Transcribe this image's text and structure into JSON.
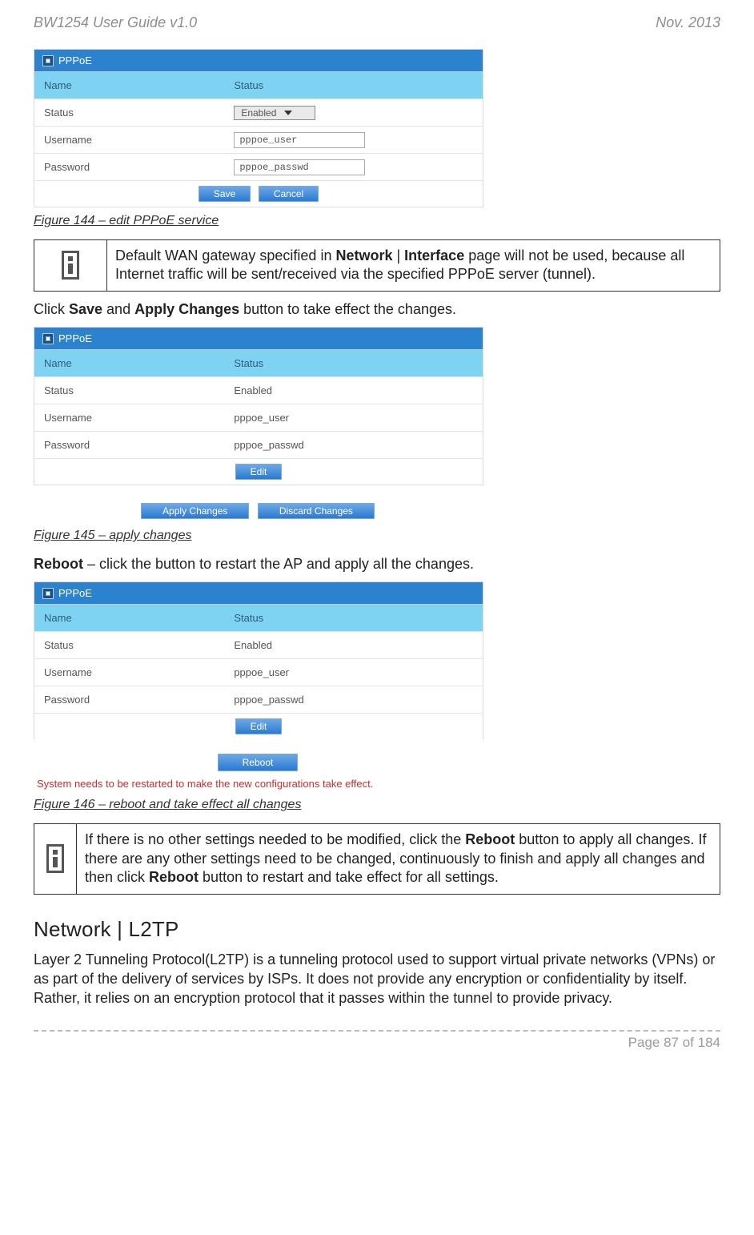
{
  "header": {
    "left": "BW1254 User Guide v1.0",
    "right": "Nov.  2013"
  },
  "captions": {
    "fig144": "Figure 144 – edit PPPoE service",
    "fig145": "Figure 145 – apply changes",
    "fig146": "Figure 146 – reboot and take effect all changes"
  },
  "info1": {
    "pre": "Default WAN gateway specified in ",
    "b1": "Network",
    "sep": " | ",
    "b2": "Interface",
    "post": " page will not be used, because all Internet traffic will be sent/received via the specified PPPoE server (tunnel)."
  },
  "line_save": {
    "pre": "Click ",
    "b1": "Save",
    "mid": " and ",
    "b2": "Apply Changes",
    "post": " button to take effect the changes."
  },
  "line_reboot": {
    "b": "Reboot",
    "post": " – click the button to restart the AP and apply all the changes."
  },
  "info2": {
    "pre": "If there is no other settings needed to be modified, click the ",
    "b1": "Reboot",
    "mid": " button to apply all changes. If there are any other settings need to be changed, continuously to finish and apply all changes and then click ",
    "b2": "Reboot",
    "post": " button to restart and take effect  for all settings."
  },
  "section": {
    "title": "Network | L2TP",
    "para": "Layer 2 Tunneling Protocol(L2TP) is a tunneling protocol used to support virtual private networks (VPNs) or as part of the delivery of services by ISPs. It does not provide any encryption or confidentiality by itself. Rather, it relies on an encryption protocol that it passes within the tunnel to provide privacy."
  },
  "panel": {
    "title": "PPPoE",
    "head_name": "Name",
    "head_status": "Status",
    "row_status": "Status",
    "row_user": "Username",
    "row_pass": "Password",
    "val_enabled": "Enabled",
    "val_user": "pppoe_user",
    "val_pass": "pppoe_passwd",
    "btn_save": "Save",
    "btn_cancel": "Cancel",
    "btn_edit": "Edit",
    "btn_apply": "Apply Changes",
    "btn_discard": "Discard Changes",
    "btn_reboot": "Reboot",
    "red_note": "System needs to be restarted to make the new configurations take effect."
  },
  "footer": {
    "page": "Page 87 of 184"
  }
}
